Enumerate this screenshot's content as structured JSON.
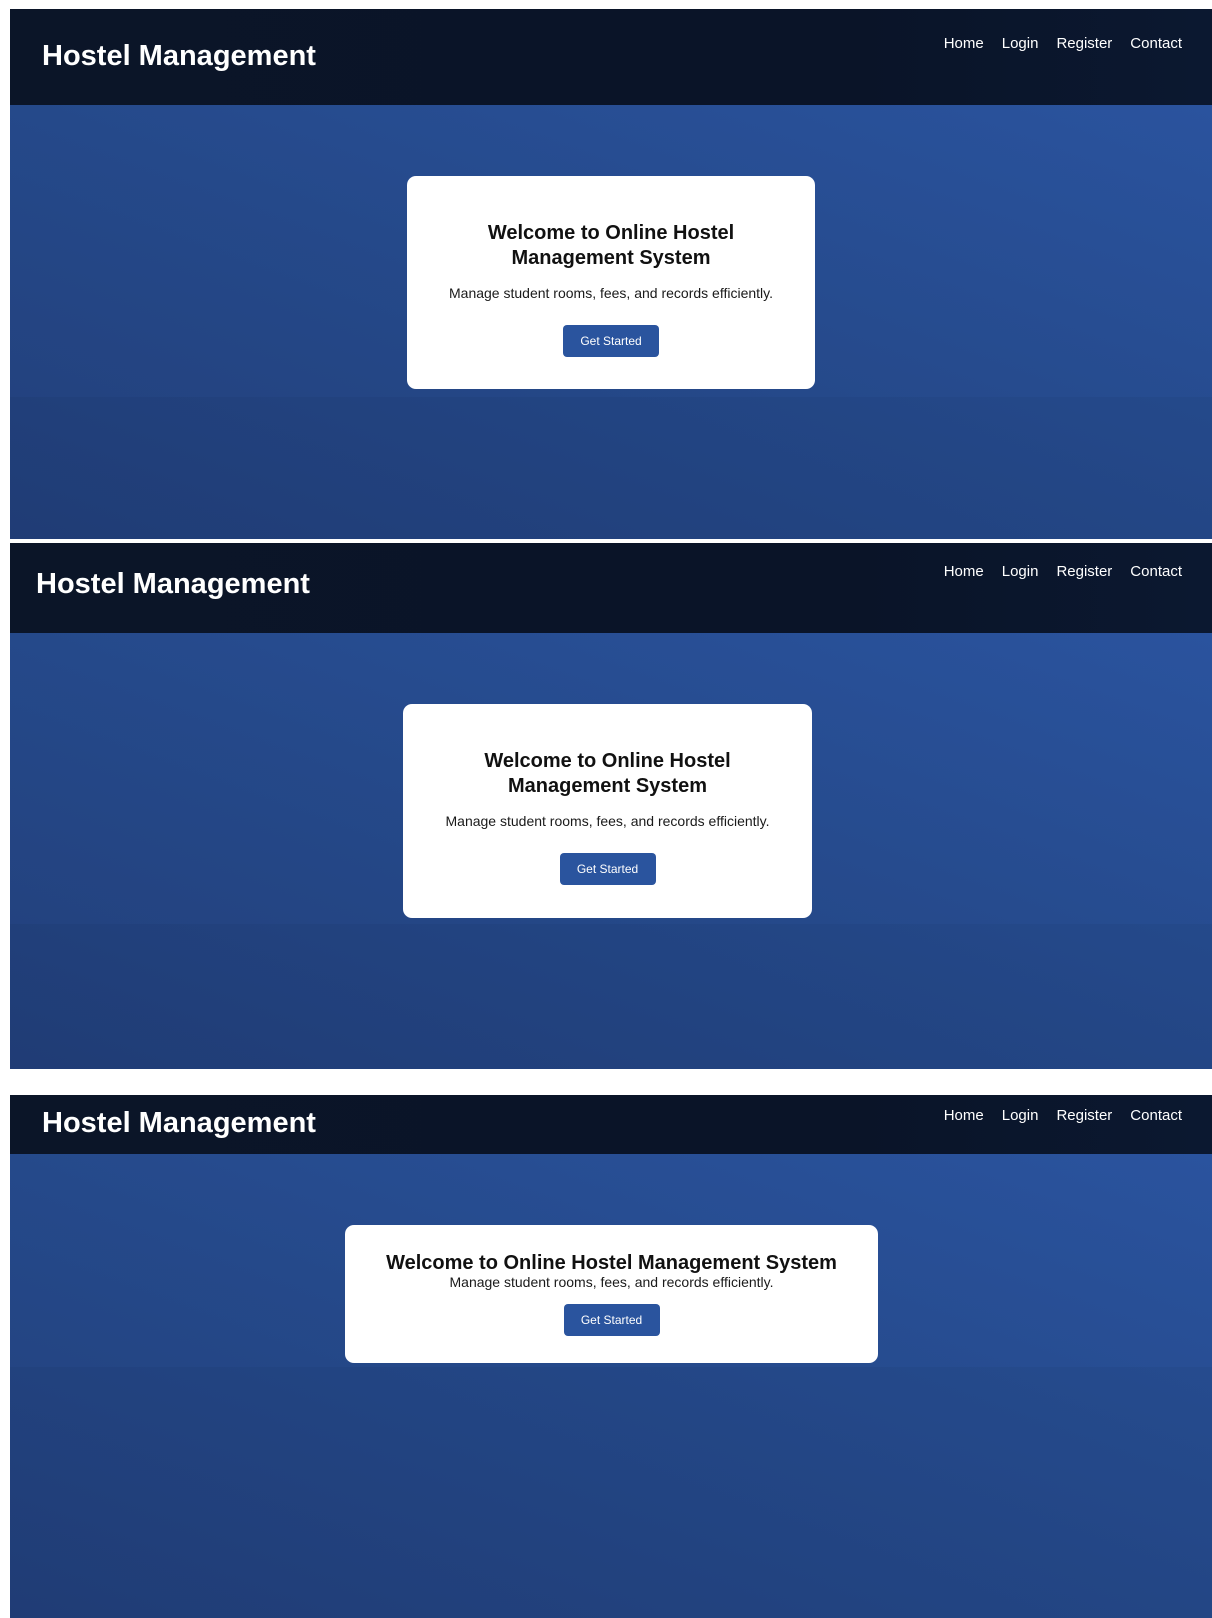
{
  "brand": "Hostel Management",
  "nav": [
    "Home",
    "Login",
    "Register",
    "Contact"
  ],
  "hero": {
    "title": "Welcome to Online Hostel Management System",
    "description": "Manage student rooms, fees, and records efficiently.",
    "cta_label": "Get Started"
  },
  "colors": {
    "navbar": "#0a1428",
    "hero": "#25498a",
    "button": "#2a549e",
    "card": "#ffffff"
  }
}
